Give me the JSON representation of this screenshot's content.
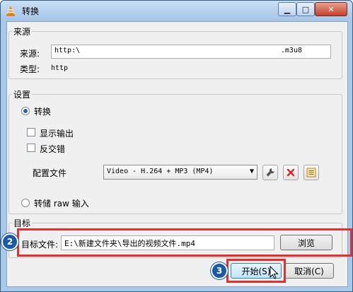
{
  "window": {
    "title": "转换",
    "minimize_glyph": "▁",
    "maximize_glyph": "□",
    "close_glyph": "✕"
  },
  "source": {
    "group_title": "来源",
    "source_label": "来源:",
    "source_value_start": "http:\\",
    "source_value_end": ".m3u8",
    "type_label": "类型:",
    "type_value": "http"
  },
  "settings": {
    "group_title": "设置",
    "convert_label": "转换",
    "show_output_label": "显示输出",
    "deinterlace_label": "反交错",
    "profile_label": "配置文件",
    "profile_value": "Video - H.264 + MP3 (MP4)",
    "dump_raw_label": "转储 raw 输入"
  },
  "destination": {
    "group_title": "目标",
    "file_label": "目标文件:",
    "file_value": "E:\\新建文件夹\\导出的视频文件.mp4",
    "browse_label": "浏览"
  },
  "footer": {
    "start_label": "开始(S)",
    "cancel_label": "取消(C)"
  },
  "annotations": {
    "step2": "2",
    "step3": "3"
  },
  "colors": {
    "highlight_box": "#e03030",
    "step_badge": "#1a5aa8"
  }
}
